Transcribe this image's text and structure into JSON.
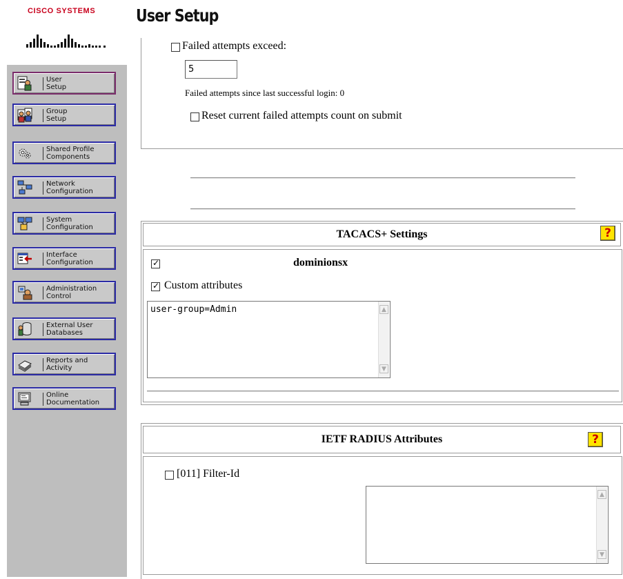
{
  "brand": {
    "name": "Cisco Systems",
    "color": "#c8001c"
  },
  "page": {
    "title": "User Setup"
  },
  "nav": {
    "items": [
      {
        "label": "User\nSetup",
        "icon": "user-setup-icon",
        "border": "#7a2c6b"
      },
      {
        "label": "Group\nSetup",
        "icon": "group-setup-icon",
        "border": "#2a2aa5"
      },
      {
        "label": "Shared Profile\nComponents",
        "icon": "shared-profile-icon",
        "border": "#2a2aa5"
      },
      {
        "label": "Network\nConfiguration",
        "icon": "network-config-icon",
        "border": "#2a2aa5"
      },
      {
        "label": "System\nConfiguration",
        "icon": "system-config-icon",
        "border": "#2a2aa5"
      },
      {
        "label": "Interface\nConfiguration",
        "icon": "interface-config-icon",
        "border": "#2a2aa5"
      },
      {
        "label": "Administration\nControl",
        "icon": "admin-control-icon",
        "border": "#2a2aa5"
      },
      {
        "label": "External User\nDatabases",
        "icon": "external-db-icon",
        "border": "#2a2aa5"
      },
      {
        "label": "Reports and\nActivity",
        "icon": "reports-icon",
        "border": "#2a2aa5"
      },
      {
        "label": "Online\nDocumentation",
        "icon": "online-doc-icon",
        "border": "#2a2aa5"
      }
    ]
  },
  "failed_attempts": {
    "checkbox_label": "Failed attempts exceed:",
    "checked": false,
    "value": "5",
    "since_text": "Failed attempts since last successful login: 0",
    "reset_label": "Reset current failed attempts count on submit",
    "reset_checked": false
  },
  "tacacs": {
    "header": "TACACS+ Settings",
    "service_name": "dominionsx",
    "service_checked": true,
    "custom_label": "Custom attributes",
    "custom_checked": true,
    "custom_value": "user-group=Admin"
  },
  "radius": {
    "header": "IETF RADIUS Attributes",
    "filter_label": "[011] Filter-Id",
    "filter_checked": false,
    "filter_value": ""
  },
  "help_symbol": "?"
}
